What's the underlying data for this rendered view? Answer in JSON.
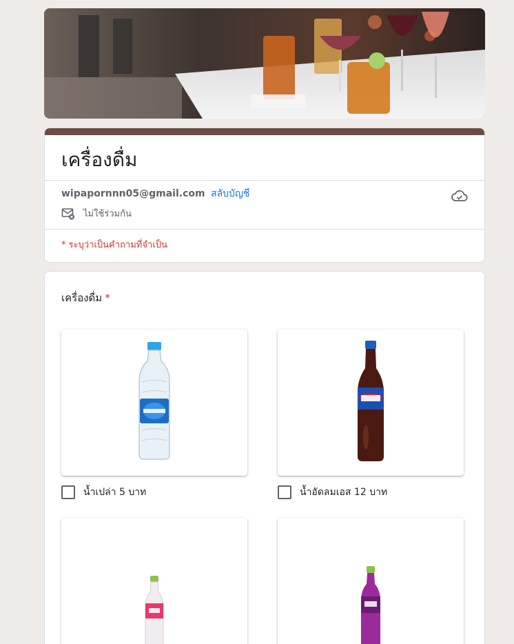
{
  "form": {
    "title": "เครื่องดื่ม",
    "account_email": "wipapornnn05@gmail.com",
    "switch_account": "สลับบัญชี",
    "not_shared": "ไม่ใช้ร่วมกัน",
    "required_note": "* ระบุว่าเป็นคำถามที่จำเป็น",
    "accent_color": "#6d4c41"
  },
  "question": {
    "title": "เครื่องดื่ม",
    "required_mark": "*",
    "options": [
      {
        "label": "น้ำเปล่า 5 บาท",
        "image": "water-bottle",
        "checked": false
      },
      {
        "label": "น้ำอัดลมเอส 12 บาท",
        "image": "est-cola-bottle",
        "checked": false
      },
      {
        "label": "",
        "image": "pink-soda-bottle",
        "checked": false
      },
      {
        "label": "",
        "image": "purple-soda-bottle",
        "checked": false
      }
    ]
  }
}
